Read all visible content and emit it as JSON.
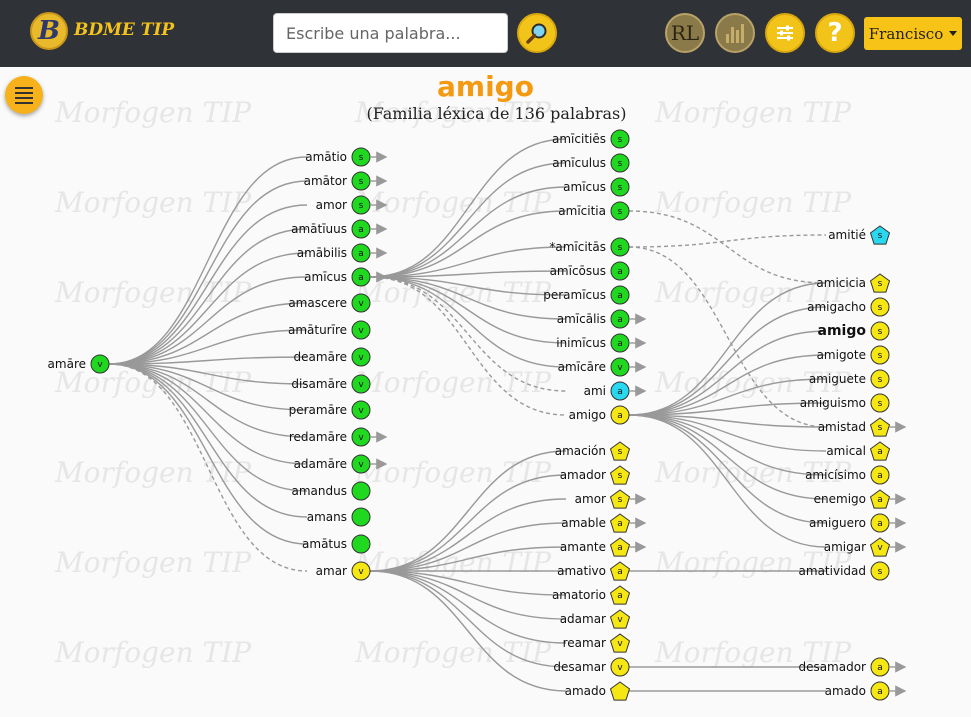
{
  "header": {
    "brand_letter": "B",
    "brand": "BDME TIP",
    "search_placeholder": "Escribe una palabra...",
    "rl_label": "RL",
    "help_label": "?",
    "user_name": "Francisco"
  },
  "page": {
    "title": "amigo",
    "subtitle": "(Familia léxica de 136 palabras)",
    "watermark": "Morfogen TIP"
  },
  "colors": {
    "green": "#1fd81f",
    "yellow": "#f5e614",
    "cyan": "#29d7ee",
    "edge": "#999999",
    "accent": "#f49a12"
  },
  "tree": {
    "root": "amāre",
    "nodes": [
      {
        "id": "amare",
        "label": "amāre",
        "tag": "v",
        "color": "green",
        "shape": "circle"
      },
      {
        "id": "amatio",
        "label": "amātio",
        "tag": "s",
        "color": "green",
        "shape": "circle",
        "more": true
      },
      {
        "id": "amator",
        "label": "amātor",
        "tag": "s",
        "color": "green",
        "shape": "circle",
        "more": true
      },
      {
        "id": "amor_la",
        "label": "amor",
        "tag": "s",
        "color": "green",
        "shape": "circle",
        "more": true
      },
      {
        "id": "amatiuus",
        "label": "amātīuus",
        "tag": "a",
        "color": "green",
        "shape": "circle",
        "more": true
      },
      {
        "id": "amabilis",
        "label": "amābilis",
        "tag": "a",
        "color": "green",
        "shape": "circle",
        "more": true
      },
      {
        "id": "amicus",
        "label": "amīcus",
        "tag": "a",
        "color": "green",
        "shape": "circle",
        "more": true
      },
      {
        "id": "amascere",
        "label": "amascere",
        "tag": "v",
        "color": "green",
        "shape": "circle"
      },
      {
        "id": "amaturire",
        "label": "amāturīre",
        "tag": "v",
        "color": "green",
        "shape": "circle"
      },
      {
        "id": "deamare",
        "label": "deamāre",
        "tag": "v",
        "color": "green",
        "shape": "circle"
      },
      {
        "id": "disamare",
        "label": "disamāre",
        "tag": "v",
        "color": "green",
        "shape": "circle"
      },
      {
        "id": "peramare",
        "label": "peramāre",
        "tag": "v",
        "color": "green",
        "shape": "circle"
      },
      {
        "id": "redamare",
        "label": "redamāre",
        "tag": "v",
        "color": "green",
        "shape": "circle",
        "more": true
      },
      {
        "id": "adamare",
        "label": "adamāre",
        "tag": "v",
        "color": "green",
        "shape": "circle",
        "more": true
      },
      {
        "id": "amandus",
        "label": "amandus",
        "tag": "",
        "color": "green",
        "shape": "circle"
      },
      {
        "id": "amans",
        "label": "amans",
        "tag": "",
        "color": "green",
        "shape": "circle"
      },
      {
        "id": "amatus",
        "label": "amātus",
        "tag": "",
        "color": "green",
        "shape": "circle"
      },
      {
        "id": "amar",
        "label": "amar",
        "tag": "v",
        "color": "yellow",
        "shape": "circle"
      },
      {
        "id": "amicities",
        "label": "amīcitiēs",
        "tag": "s",
        "color": "green",
        "shape": "circle"
      },
      {
        "id": "amiculus",
        "label": "amīculus",
        "tag": "s",
        "color": "green",
        "shape": "circle"
      },
      {
        "id": "amicus2",
        "label": "amīcus",
        "tag": "s",
        "color": "green",
        "shape": "circle"
      },
      {
        "id": "amicitia",
        "label": "amīcitia",
        "tag": "s",
        "color": "green",
        "shape": "circle"
      },
      {
        "id": "amicitas",
        "label": "*amīcitās",
        "tag": "s",
        "color": "green",
        "shape": "circle"
      },
      {
        "id": "amicosus",
        "label": "amīcōsus",
        "tag": "a",
        "color": "green",
        "shape": "circle"
      },
      {
        "id": "peramicus",
        "label": "peramīcus",
        "tag": "a",
        "color": "green",
        "shape": "circle"
      },
      {
        "id": "amicalis",
        "label": "amīcālis",
        "tag": "a",
        "color": "green",
        "shape": "circle",
        "more": true
      },
      {
        "id": "inimicus",
        "label": "inimīcus",
        "tag": "a",
        "color": "green",
        "shape": "circle",
        "more": true
      },
      {
        "id": "amicare",
        "label": "amīcāre",
        "tag": "v",
        "color": "green",
        "shape": "circle",
        "more": true
      },
      {
        "id": "ami",
        "label": "ami",
        "tag": "a",
        "color": "cyan",
        "shape": "circle",
        "more": true
      },
      {
        "id": "amigo_n",
        "label": "amigo",
        "tag": "a",
        "color": "yellow",
        "shape": "circle"
      },
      {
        "id": "amitie",
        "label": "amitié",
        "tag": "s",
        "color": "cyan",
        "shape": "pentagon"
      },
      {
        "id": "amicicia",
        "label": "amicicia",
        "tag": "s",
        "color": "yellow",
        "shape": "pentagon"
      },
      {
        "id": "amigacho",
        "label": "amigacho",
        "tag": "s",
        "color": "yellow",
        "shape": "circle"
      },
      {
        "id": "amigo_bold",
        "label": "amigo",
        "tag": "s",
        "color": "yellow",
        "shape": "circle",
        "bold": true
      },
      {
        "id": "amigote",
        "label": "amigote",
        "tag": "s",
        "color": "yellow",
        "shape": "circle"
      },
      {
        "id": "amiguete",
        "label": "amiguete",
        "tag": "s",
        "color": "yellow",
        "shape": "circle"
      },
      {
        "id": "amiguismo",
        "label": "amiguismo",
        "tag": "s",
        "color": "yellow",
        "shape": "circle"
      },
      {
        "id": "amistad",
        "label": "amistad",
        "tag": "s",
        "color": "yellow",
        "shape": "pentagon",
        "more": true
      },
      {
        "id": "amical",
        "label": "amical",
        "tag": "a",
        "color": "yellow",
        "shape": "pentagon"
      },
      {
        "id": "amicisimo",
        "label": "amicísimo",
        "tag": "a",
        "color": "yellow",
        "shape": "circle"
      },
      {
        "id": "enemigo",
        "label": "enemigo",
        "tag": "a",
        "color": "yellow",
        "shape": "pentagon",
        "more": true
      },
      {
        "id": "amiguero",
        "label": "amiguero",
        "tag": "a",
        "color": "yellow",
        "shape": "circle",
        "more": true
      },
      {
        "id": "amigar",
        "label": "amigar",
        "tag": "v",
        "color": "yellow",
        "shape": "pentagon",
        "more": true
      },
      {
        "id": "amacion",
        "label": "amación",
        "tag": "s",
        "color": "yellow",
        "shape": "pentagon"
      },
      {
        "id": "amador",
        "label": "amador",
        "tag": "s",
        "color": "yellow",
        "shape": "pentagon"
      },
      {
        "id": "amor_es",
        "label": "amor",
        "tag": "s",
        "color": "yellow",
        "shape": "pentagon",
        "more": true
      },
      {
        "id": "amable",
        "label": "amable",
        "tag": "a",
        "color": "yellow",
        "shape": "pentagon",
        "more": true
      },
      {
        "id": "amante",
        "label": "amante",
        "tag": "a",
        "color": "yellow",
        "shape": "pentagon",
        "more": true
      },
      {
        "id": "amativo",
        "label": "amativo",
        "tag": "a",
        "color": "yellow",
        "shape": "pentagon"
      },
      {
        "id": "amatorio",
        "label": "amatorio",
        "tag": "a",
        "color": "yellow",
        "shape": "pentagon"
      },
      {
        "id": "adamar",
        "label": "adamar",
        "tag": "v",
        "color": "yellow",
        "shape": "pentagon"
      },
      {
        "id": "reamar",
        "label": "reamar",
        "tag": "v",
        "color": "yellow",
        "shape": "pentagon"
      },
      {
        "id": "desamar",
        "label": "desamar",
        "tag": "v",
        "color": "yellow",
        "shape": "circle"
      },
      {
        "id": "amado",
        "label": "amado",
        "tag": "",
        "color": "yellow",
        "shape": "pentagon"
      },
      {
        "id": "amatividad",
        "label": "amatividad",
        "tag": "s",
        "color": "yellow",
        "shape": "circle"
      },
      {
        "id": "desamador",
        "label": "desamador",
        "tag": "a",
        "color": "yellow",
        "shape": "circle",
        "more": true
      },
      {
        "id": "amado2",
        "label": "amado",
        "tag": "a",
        "color": "yellow",
        "shape": "circle",
        "more": true
      }
    ],
    "edges": [
      [
        "amare",
        "amatio"
      ],
      [
        "amare",
        "amator"
      ],
      [
        "amare",
        "amor_la"
      ],
      [
        "amare",
        "amatiuus"
      ],
      [
        "amare",
        "amabilis"
      ],
      [
        "amare",
        "amicus"
      ],
      [
        "amare",
        "amascere"
      ],
      [
        "amare",
        "amaturire"
      ],
      [
        "amare",
        "deamare"
      ],
      [
        "amare",
        "disamare"
      ],
      [
        "amare",
        "peramare"
      ],
      [
        "amare",
        "redamare"
      ],
      [
        "amare",
        "adamare"
      ],
      [
        "amare",
        "amandus"
      ],
      [
        "amare",
        "amans"
      ],
      [
        "amare",
        "amatus"
      ],
      [
        "amicus",
        "amicities"
      ],
      [
        "amicus",
        "amiculus"
      ],
      [
        "amicus",
        "amicus2"
      ],
      [
        "amicus",
        "amicitia"
      ],
      [
        "amicus",
        "amicitas"
      ],
      [
        "amicus",
        "amicosus"
      ],
      [
        "amicus",
        "peramicus"
      ],
      [
        "amicus",
        "amicalis"
      ],
      [
        "amicus",
        "inimicus"
      ],
      [
        "amicus",
        "amicare"
      ],
      [
        "amigo_n",
        "amicicia"
      ],
      [
        "amigo_n",
        "amigacho"
      ],
      [
        "amigo_n",
        "amigo_bold"
      ],
      [
        "amigo_n",
        "amigote"
      ],
      [
        "amigo_n",
        "amiguete"
      ],
      [
        "amigo_n",
        "amiguismo"
      ],
      [
        "amigo_n",
        "amistad"
      ],
      [
        "amigo_n",
        "amical"
      ],
      [
        "amigo_n",
        "amicisimo"
      ],
      [
        "amigo_n",
        "enemigo"
      ],
      [
        "amigo_n",
        "amiguero"
      ],
      [
        "amigo_n",
        "amigar"
      ],
      [
        "amar",
        "amacion"
      ],
      [
        "amar",
        "amador"
      ],
      [
        "amar",
        "amor_es"
      ],
      [
        "amar",
        "amable"
      ],
      [
        "amar",
        "amante"
      ],
      [
        "amar",
        "amativo"
      ],
      [
        "amar",
        "amatorio"
      ],
      [
        "amar",
        "adamar"
      ],
      [
        "amar",
        "reamar"
      ],
      [
        "amar",
        "desamar"
      ],
      [
        "amar",
        "amado"
      ],
      [
        "amativo",
        "amatividad"
      ],
      [
        "desamar",
        "desamador"
      ],
      [
        "amado",
        "amado2"
      ]
    ],
    "dashed_edges": [
      [
        "amare",
        "amar"
      ],
      [
        "amicus",
        "ami"
      ],
      [
        "amicus",
        "amigo_n"
      ],
      [
        "amicitia",
        "amicicia"
      ],
      [
        "amicitas",
        "amitie"
      ],
      [
        "amicitas",
        "amistad"
      ]
    ]
  }
}
